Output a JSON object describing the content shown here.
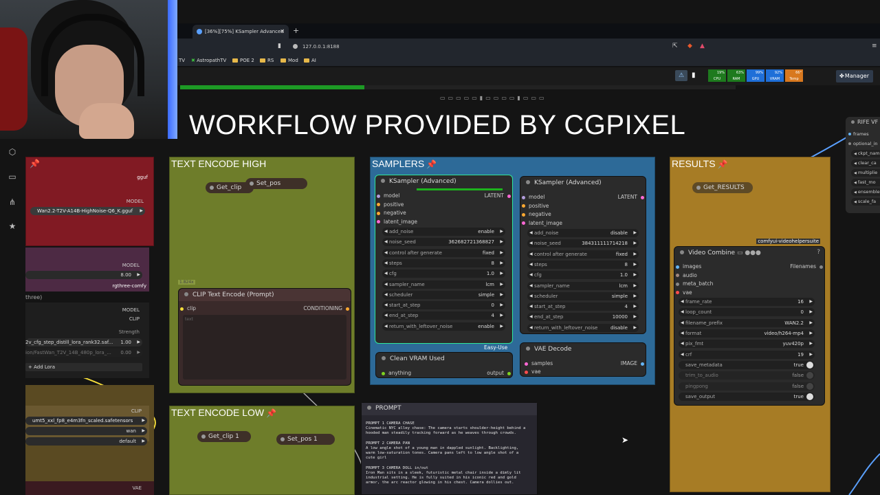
{
  "browser": {
    "tab_title": "[36%][75%] KSampler Advanced",
    "url": "127.0.0.1:8188",
    "bookmarks": [
      "TV",
      "AstropathTV",
      "POE 2",
      "RS",
      "Mod",
      "AI"
    ]
  },
  "comfy_bar": {
    "stats": [
      {
        "label": "CPU",
        "value": "19%",
        "color": "#1e7a1e"
      },
      {
        "label": "RAM",
        "value": "63%",
        "color": "#1e7a1e"
      },
      {
        "label": "GPU",
        "value": "99%",
        "color": "#1f6fd8"
      },
      {
        "label": "VRAM",
        "value": "92%",
        "color": "#1f6fd8"
      },
      {
        "label": "Temp",
        "value": "66°",
        "color": "#d8781f"
      }
    ],
    "manager_label": "Manager",
    "progress_percent": 36
  },
  "overlay_title": "WORKFLOW PROVIDED BY CGPIXEL",
  "groups": {
    "text_encode_high": "TEXT ENCODE HIGH",
    "text_encode_low": "TEXT ENCODE LOW",
    "samplers": "SAMPLERS",
    "results": "RESULTS"
  },
  "left_panel": {
    "gguf_label": "gguf",
    "model_label": "MODEL",
    "model_file": "Wan2.2-T2V-A14B-HighNoise-Q6_K.gguf",
    "model2_label": "MODEL",
    "strength_val": "8.00",
    "rgthree": "rgthree-comfy",
    "three": "three)",
    "lora_model": "MODEL",
    "lora_clip": "CLIP",
    "strength_label": "Strength",
    "lora1": "2v_cfg_step_distill_lora_rank32.saf...",
    "lora1_val": "1.00",
    "lora2": "ion/FastWan_T2V_14B_480p_lora_...",
    "lora2_val": "0.00",
    "add_lora": "+ Add Lora",
    "clip_out": "CLIP",
    "clip_file": "umt5_xxl_fp8_e4m3fn_scaled.safetensors",
    "clip_type": "wan",
    "clip_device": "default",
    "vae_out": "VAE"
  },
  "text_high": {
    "get_clip": "Get_clip",
    "set_pos": "Set_pos",
    "size_badge": "1.824x",
    "clip_node_title": "CLIP Text Encode (Prompt)",
    "clip_in": "clip",
    "cond_out": "CONDITIONING",
    "text_placeholder": "text"
  },
  "text_low": {
    "get_clip": "Get_clip 1",
    "set_pos": "Set_pos 1"
  },
  "ksampler1": {
    "title": "KSampler (Advanced)",
    "inputs": [
      "model",
      "positive",
      "negative",
      "latent_image"
    ],
    "output": "LATENT",
    "widgets": [
      {
        "name": "add_noise",
        "value": "enable"
      },
      {
        "name": "noise_seed",
        "value": "362682721368827"
      },
      {
        "name": "control after generate",
        "value": "fixed"
      },
      {
        "name": "steps",
        "value": "8"
      },
      {
        "name": "cfg",
        "value": "1.0"
      },
      {
        "name": "sampler_name",
        "value": "lcm"
      },
      {
        "name": "scheduler",
        "value": "simple"
      },
      {
        "name": "start_at_step",
        "value": "0"
      },
      {
        "name": "end_at_step",
        "value": "4"
      },
      {
        "name": "return_with_leftover_noise",
        "value": "enable"
      }
    ]
  },
  "ksampler2": {
    "title": "KSampler (Advanced)",
    "inputs": [
      "model",
      "positive",
      "negative",
      "latent_image"
    ],
    "output": "LATENT",
    "widgets": [
      {
        "name": "add_noise",
        "value": "disable"
      },
      {
        "name": "noise_seed",
        "value": "384311111714218"
      },
      {
        "name": "control after generate",
        "value": "fixed"
      },
      {
        "name": "steps",
        "value": "8"
      },
      {
        "name": "cfg",
        "value": "1.0"
      },
      {
        "name": "sampler_name",
        "value": "lcm"
      },
      {
        "name": "scheduler",
        "value": "simple"
      },
      {
        "name": "start_at_step",
        "value": "4"
      },
      {
        "name": "end_at_step",
        "value": "10000"
      },
      {
        "name": "return_with_leftover_noise",
        "value": "disable"
      }
    ]
  },
  "easy_use": "Easy-Use",
  "clean_vram": {
    "title": "Clean VRAM Used",
    "input": "anything",
    "output": "output"
  },
  "vae_decode": {
    "title": "VAE Decode",
    "inputs": [
      "samples",
      "vae"
    ],
    "output": "IMAGE"
  },
  "prompt_node": {
    "title": "PROMPT",
    "lines": [
      "PROMPT 1 CAMERA CHASE",
      "Cinematic NYC alley chase: The camera starts shoulder-height behind a",
      "hooded man steadily tracking forward as he weaves through crowds.",
      "",
      "PROMPT 2 CAMERA PAN",
      "A low angle shot of a young man in dappled sunlight. Backlighting,",
      "warm low-saturation tones. Camera pans left to low angle shot of a",
      "cute girl",
      "",
      "PROMPT 3 CAMERA DOLL in/out",
      "Iron Man sits in a sleek, futuristic metal chair inside a dimly lit",
      "industrial setting. He is fully suited in his iconic red and gold",
      "armor, the arc reactor glowing in his chest. Camera dollies out."
    ]
  },
  "results": {
    "get_results": "Get_RESULTS",
    "videohelper": "comfyui-videohelpersuite",
    "vc_title": "Video Combine",
    "inputs": [
      "images",
      "audio",
      "meta_batch",
      "vae"
    ],
    "filenames": "Filenames",
    "widgets": [
      {
        "name": "frame_rate",
        "value": "16"
      },
      {
        "name": "loop_count",
        "value": "0"
      },
      {
        "name": "filename_prefix",
        "value": "WAN2.2"
      },
      {
        "name": "format",
        "value": "video/h264-mp4"
      },
      {
        "name": "pix_fmt",
        "value": "yuv420p"
      },
      {
        "name": "crf",
        "value": "19"
      }
    ],
    "toggles": [
      {
        "name": "save_metadata",
        "value": "true"
      },
      {
        "name": "trim_to_audio",
        "value": "false"
      },
      {
        "name": "pingpong",
        "value": "false"
      },
      {
        "name": "save_output",
        "value": "true"
      }
    ]
  },
  "rife": {
    "title": "RIFE VF",
    "items": [
      "frames",
      "optional_in",
      "ckpt_nam",
      "clear_ca",
      "multiplie",
      "fast_mo",
      "ensemble",
      "scale_fa"
    ]
  }
}
